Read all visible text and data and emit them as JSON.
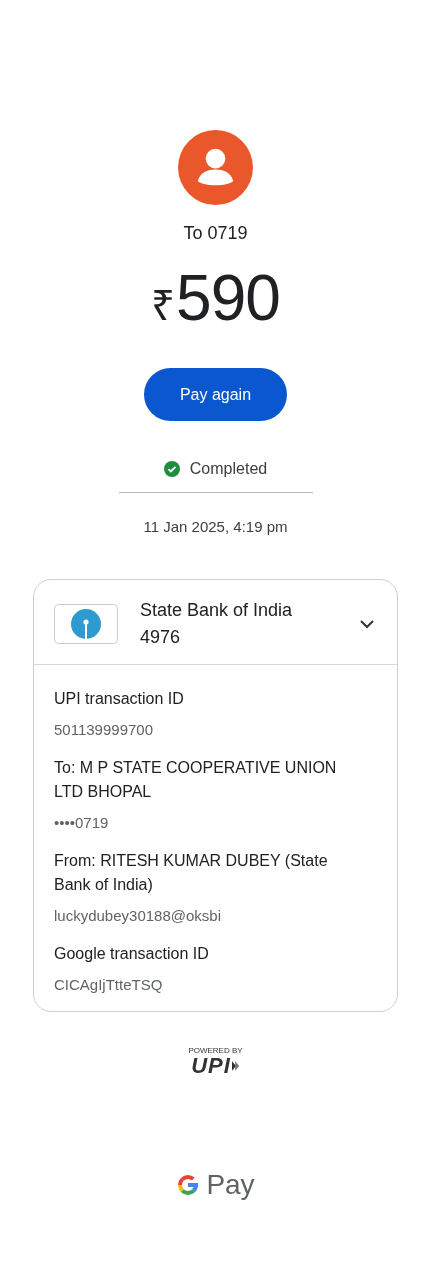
{
  "recipient": {
    "label": "To 0719"
  },
  "amount": {
    "currency": "₹",
    "value": "590"
  },
  "pay_again_button": {
    "label": "Pay again"
  },
  "status": {
    "label": "Completed",
    "completed": true
  },
  "datetime": "11 Jan 2025, 4:19 pm",
  "account": {
    "bank": "State Bank of India",
    "number": "4976",
    "expanded": false
  },
  "details": [
    {
      "label": "UPI transaction ID",
      "value": "501139999700"
    },
    {
      "label": "To: M P STATE COOPERATIVE UNION LTD BHOPAL",
      "value": "••••0719"
    },
    {
      "label": "From: RITESH KUMAR DUBEY (State Bank of India)",
      "value": "luckydubey30188@oksbi"
    },
    {
      "label": "Google transaction ID",
      "value": "CICAgIjTtteTSQ"
    }
  ],
  "powered_by": {
    "caption": "POWERED BY",
    "brand": "UPI"
  },
  "footer": {
    "brand": "Pay"
  }
}
